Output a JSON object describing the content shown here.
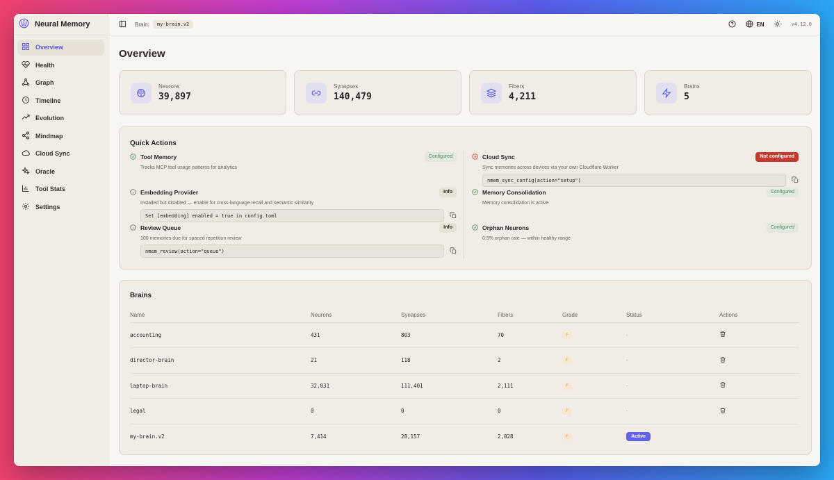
{
  "app": {
    "name": "Neural Memory",
    "version": "v4.12.0"
  },
  "sidebar": {
    "items": [
      {
        "label": "Overview",
        "icon": "grid-icon",
        "active": true
      },
      {
        "label": "Health",
        "icon": "heart-pulse-icon"
      },
      {
        "label": "Graph",
        "icon": "network-icon"
      },
      {
        "label": "Timeline",
        "icon": "clock-icon"
      },
      {
        "label": "Evolution",
        "icon": "trending-up-icon"
      },
      {
        "label": "Mindmap",
        "icon": "share-icon"
      },
      {
        "label": "Cloud Sync",
        "icon": "cloud-icon"
      },
      {
        "label": "Oracle",
        "icon": "sparkles-icon"
      },
      {
        "label": "Tool Stats",
        "icon": "bar-chart-icon"
      },
      {
        "label": "Settings",
        "icon": "gear-icon"
      }
    ]
  },
  "topbar": {
    "brain_label": "Brain:",
    "brain_name": "my-brain.v2",
    "lang": "EN",
    "version": "v4.12.0"
  },
  "page": {
    "title": "Overview"
  },
  "stats": [
    {
      "label": "Neurons",
      "value": "39,897",
      "icon": "brain-icon"
    },
    {
      "label": "Synapses",
      "value": "140,479",
      "icon": "link-icon"
    },
    {
      "label": "Fibers",
      "value": "4,211",
      "icon": "layers-icon"
    },
    {
      "label": "Brains",
      "value": "5",
      "icon": "zap-icon"
    }
  ],
  "quick_actions": {
    "title": "Quick Actions",
    "left": [
      {
        "name": "Tool Memory",
        "badge": "Configured",
        "desc": "Tracks MCP tool usage patterns for analytics"
      },
      {
        "name": "Embedding Provider",
        "badge": "Info",
        "desc": "Installed but disabled — enable for cross-language recall and semantic similarity",
        "code": "Set [embedding] enabled = true in config.toml"
      },
      {
        "name": "Review Queue",
        "badge": "Info",
        "desc": "100 memories due for spaced repetition review",
        "code": "nmem_review(action=\"queue\")"
      }
    ],
    "right": [
      {
        "name": "Cloud Sync",
        "badge": "Not configured",
        "desc": "Sync memories across devices via your own Cloudflare Worker",
        "code": "nmem_sync_config(action=\"setup\")"
      },
      {
        "name": "Memory Consolidation",
        "badge": "Configured",
        "desc": "Memory consolidation is active"
      },
      {
        "name": "Orphan Neurons",
        "badge": "Configured",
        "desc": "0.5% orphan rate — within healthy range"
      }
    ]
  },
  "brains": {
    "title": "Brains",
    "columns": [
      "Name",
      "Neurons",
      "Synapses",
      "Fibers",
      "Grade",
      "Status",
      "Actions"
    ],
    "rows": [
      {
        "name": "accounting",
        "neurons": "431",
        "synapses": "803",
        "fibers": "70",
        "grade": "F",
        "status": "-"
      },
      {
        "name": "director-brain",
        "neurons": "21",
        "synapses": "118",
        "fibers": "2",
        "grade": "F",
        "status": "-"
      },
      {
        "name": "laptop-brain",
        "neurons": "32,031",
        "synapses": "111,401",
        "fibers": "2,111",
        "grade": "F",
        "status": "-"
      },
      {
        "name": "legal",
        "neurons": "0",
        "synapses": "0",
        "fibers": "0",
        "grade": "F",
        "status": "-"
      },
      {
        "name": "my-brain.v2",
        "neurons": "7,414",
        "synapses": "28,157",
        "fibers": "2,028",
        "grade": "F",
        "status": "Active"
      }
    ]
  },
  "colors": {
    "accent": "#5b57e0",
    "ok": "#4b8a5a",
    "danger": "#c43a2c",
    "active": "#6361e6"
  }
}
